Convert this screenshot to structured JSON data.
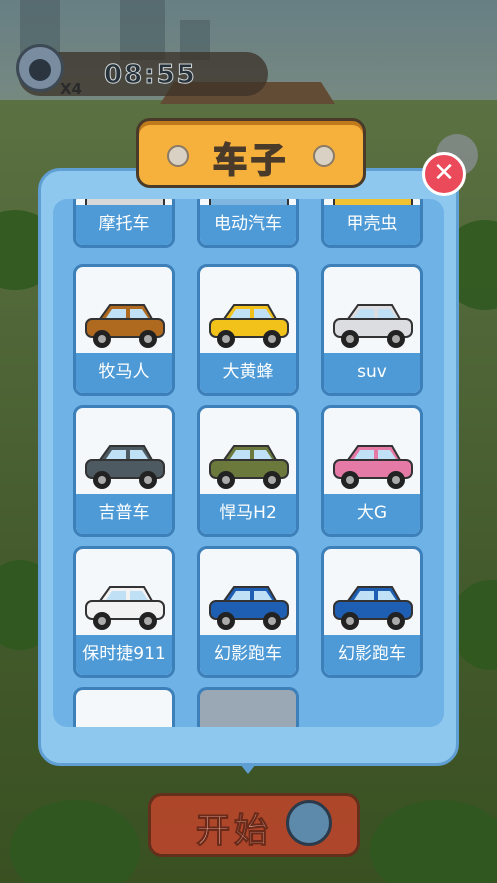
{
  "hud": {
    "bomb_count": "X4",
    "timer": "08:55"
  },
  "panel": {
    "title": "车子",
    "close_symbol": "✕"
  },
  "cars": [
    {
      "label": "摩托车",
      "color": "#d8d8d8",
      "icon": "motorcycle-icon"
    },
    {
      "label": "电动汽车",
      "color": "#7fb6e0",
      "icon": "electric-car-icon"
    },
    {
      "label": "甲壳虫",
      "color": "#f1c232",
      "icon": "beetle-icon"
    },
    {
      "label": "牧马人",
      "color": "#b06a1f",
      "icon": "wrangler-icon"
    },
    {
      "label": "大黄蜂",
      "color": "#f2c21b",
      "icon": "bumblebee-icon"
    },
    {
      "label": "suv",
      "color": "#dcdde0",
      "icon": "suv-icon"
    },
    {
      "label": "吉普车",
      "color": "#4e5a62",
      "icon": "jeep-icon"
    },
    {
      "label": "悍马H2",
      "color": "#6b7a3c",
      "icon": "hummer-icon"
    },
    {
      "label": "大G",
      "color": "#e67aa6",
      "icon": "g-class-icon"
    },
    {
      "label": "保时捷911",
      "color": "#f2f2f2",
      "icon": "porsche-icon"
    },
    {
      "label": "幻影跑车",
      "color": "#1e5fb4",
      "icon": "sports-car-icon"
    },
    {
      "label": "幻影跑车",
      "color": "#1e5fb4",
      "icon": "sports-car-icon"
    }
  ],
  "start": {
    "label": "开始"
  }
}
